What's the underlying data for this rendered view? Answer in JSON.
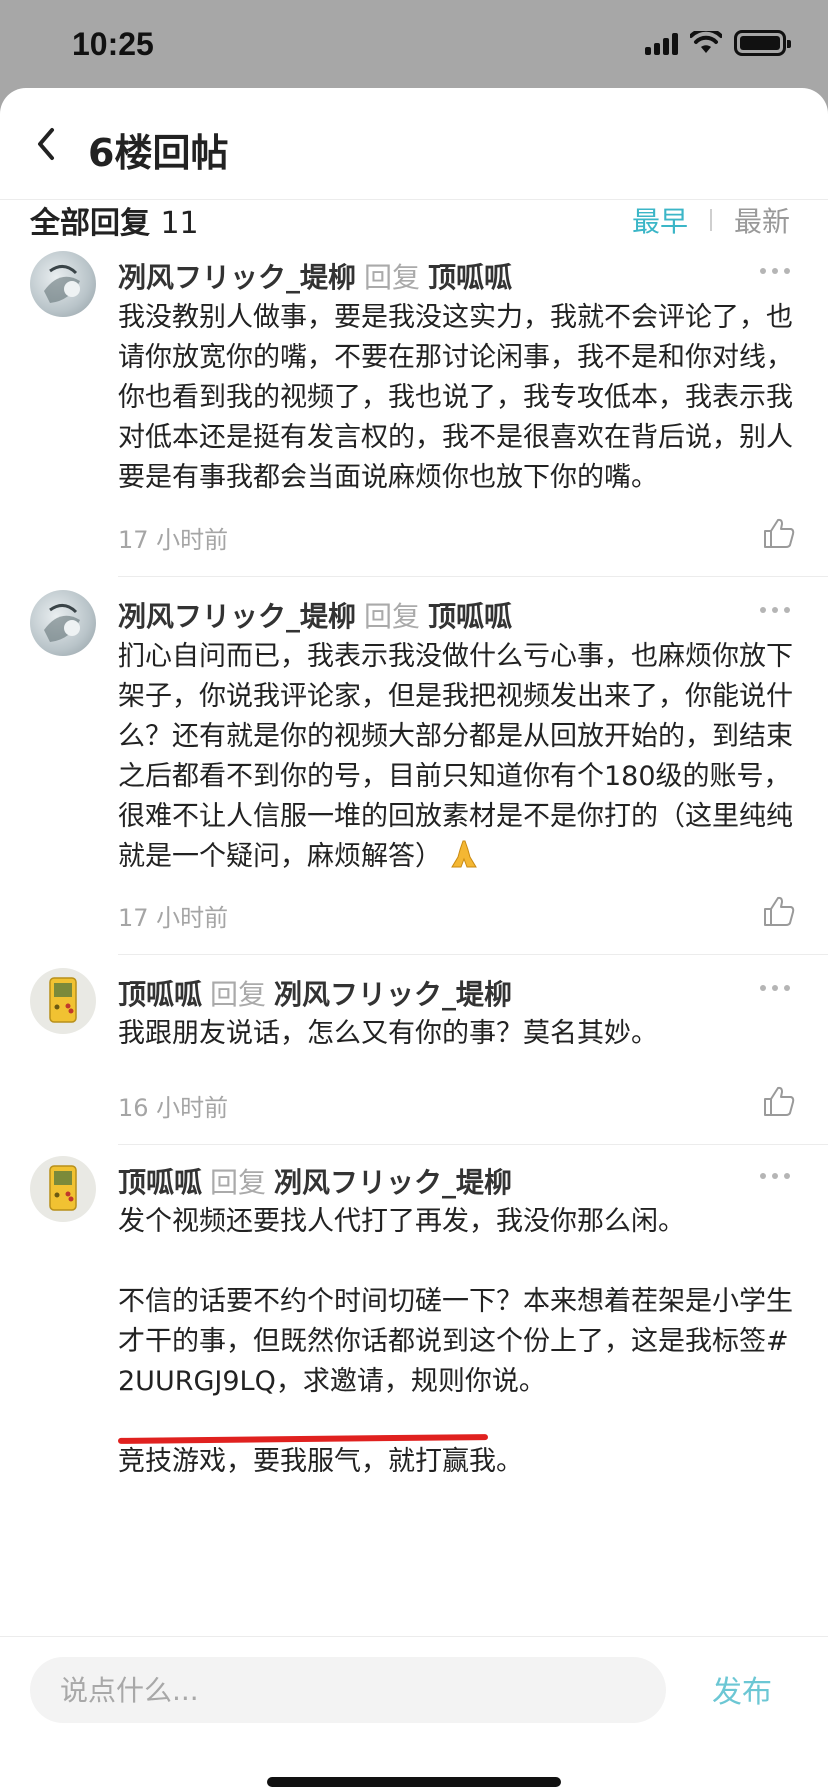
{
  "status_bar": {
    "time": "10:25"
  },
  "header": {
    "back_icon": "chevron-left-icon",
    "title": "6楼回帖"
  },
  "replies": {
    "label": "全部回复",
    "count": "11",
    "sort_earliest": "最早",
    "sort_latest": "最新",
    "accent_color": "#3bb6c7"
  },
  "comments": [
    {
      "author": "冽风フリック_堤柳",
      "reply_word": "回复",
      "reply_to": "顶呱呱",
      "text": "我没教别人做事，要是我没这实力，我就不会评论了，也请你放宽你的嘴，不要在那讨论闲事，我不是和你对线，你也看到我的视频了，我也说了，我专攻低本，我表示我对低本还是挺有发言权的，我不是很喜欢在背后说，别人要是有事我都会当面说麻烦你也放下你的嘴。",
      "time": "17 小时前"
    },
    {
      "author": "冽风フリック_堤柳",
      "reply_word": "回复",
      "reply_to": "顶呱呱",
      "text": "扪心自问而已，我表示我没做什么亏心事，也麻烦你放下架子，你说我评论家，但是我把视频发出来了，你能说什么？还有就是你的视频大部分都是从回放开始的，到结束之后都看不到你的号，目前只知道你有个180级的账号，很难不让人信服一堆的回放素材是不是你打的（这里纯纯就是一个疑问，麻烦解答）",
      "time": "17 小时前"
    },
    {
      "author": "顶呱呱",
      "reply_word": "回复",
      "reply_to": "冽风フリック_堤柳",
      "text": "我跟朋友说话，怎么又有你的事？莫名其妙。",
      "time": "16 小时前"
    },
    {
      "author": "顶呱呱",
      "reply_word": "回复",
      "reply_to": "冽风フリック_堤柳",
      "text": "发个视频还要找人代打了再发，我没你那么闲。\n\n不信的话要不约个时间切磋一下？本来想着茬架是小学生才干的事，但既然你话都说到这个份上了，这是我标签#2UURGJ9LQ，求邀请，规则你说。\n\n竞技游戏，要我服气，就打赢我。"
    }
  ],
  "composer": {
    "placeholder": "说点什么...",
    "publish_label": "发布"
  }
}
